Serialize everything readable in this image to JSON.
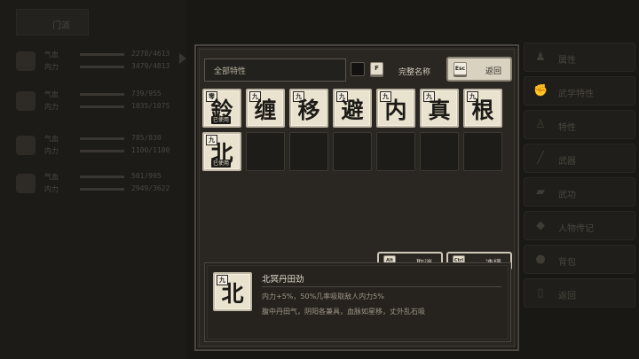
{
  "background": {
    "header_title": "门派",
    "characters": [
      {
        "hp_label": "气血",
        "mp_label": "内力",
        "hp": "2278/4613",
        "mp": "3479/4813"
      },
      {
        "hp_label": "气血",
        "mp_label": "内力",
        "hp": "739/955",
        "mp": "1035/1075"
      },
      {
        "hp_label": "气血",
        "mp_label": "内力",
        "hp": "785/830",
        "mp": "1100/1100"
      },
      {
        "hp_label": "气血",
        "mp_label": "内力",
        "hp": "501/995",
        "mp": "2949/3622"
      }
    ],
    "menu": [
      {
        "label": "属性",
        "icon": "body-icon"
      },
      {
        "label": "武学特性",
        "icon": "martial-icon"
      },
      {
        "label": "特性",
        "icon": "trait-icon"
      },
      {
        "label": "武器",
        "icon": "sword-icon"
      },
      {
        "label": "武功",
        "icon": "scroll-icon"
      },
      {
        "label": "人物传记",
        "icon": "book-icon"
      },
      {
        "label": "背包",
        "icon": "bag-icon"
      },
      {
        "label": "返回",
        "icon": "exit-icon"
      }
    ]
  },
  "panel": {
    "filter_label": "全部特性",
    "fullname_key": "F",
    "fullname_label": "完整名称",
    "back_key": "Esc",
    "back_label": "返回",
    "cards": [
      {
        "rank": "零",
        "glyph": "鈴",
        "used": "已使用"
      },
      {
        "rank": "九",
        "glyph": "缠",
        "used": ""
      },
      {
        "rank": "九",
        "glyph": "移",
        "used": ""
      },
      {
        "rank": "九",
        "glyph": "避",
        "used": ""
      },
      {
        "rank": "九",
        "glyph": "内",
        "used": ""
      },
      {
        "rank": "九",
        "glyph": "真",
        "used": ""
      },
      {
        "rank": "九",
        "glyph": "根",
        "used": ""
      },
      {
        "rank": "九",
        "glyph": "北",
        "used": "已使用"
      }
    ],
    "cancel_key": "Alt",
    "cancel_label": "取消",
    "select_key": "Ctrl",
    "select_label": "选择",
    "detail": {
      "rank": "九",
      "glyph": "北",
      "name": "北冥丹田劲",
      "line1": "内力+5%，50%几率吸取敌人内力5%",
      "line2": "腹中丹田气，阴阳各兼具，血脉如星移，丈外乱石吸"
    }
  }
}
